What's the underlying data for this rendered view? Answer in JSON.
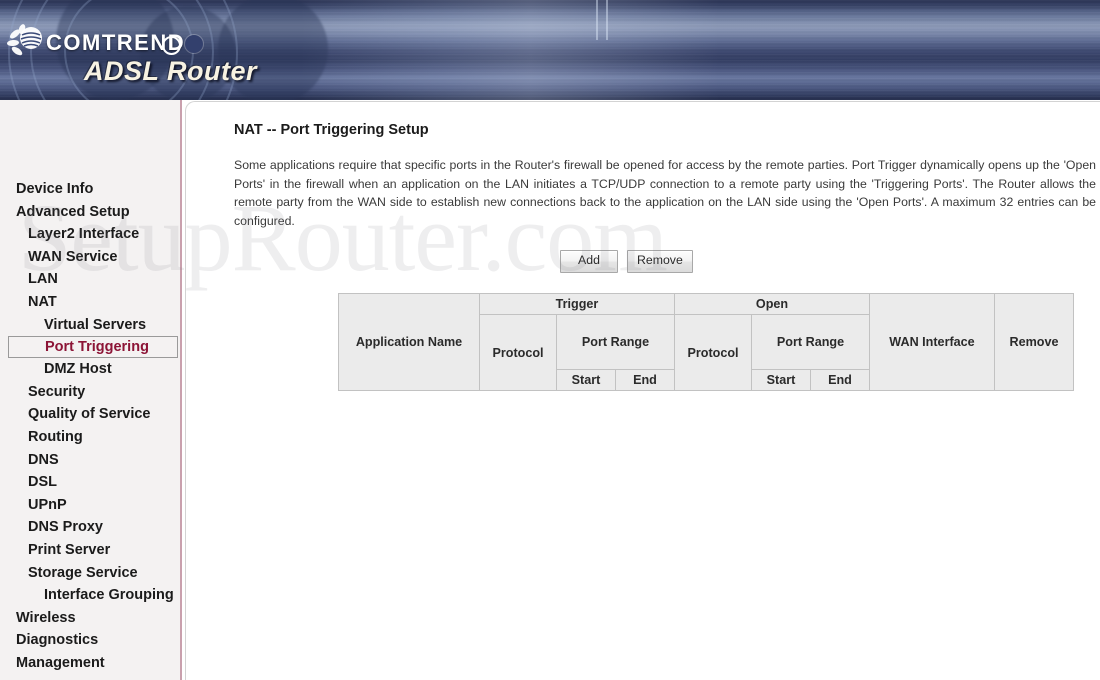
{
  "banner": {
    "brand_name": "COMTREND",
    "product_title": "ADSL Router",
    "logo_icon": "comtrend-flower-logo",
    "accent_dark": "#2a3355",
    "accent_light": "#8e9bba",
    "title_color": "#f7f2e2"
  },
  "watermark": {
    "text": "SetupRouter.com"
  },
  "sidebar": {
    "active_item": "Port Triggering",
    "active_color": "#8c1436",
    "border_color": "#c9a0ad",
    "background": "#f4f2f2",
    "items": [
      {
        "label": "Device Info",
        "level": 0,
        "active": false
      },
      {
        "label": "Advanced Setup",
        "level": 0,
        "active": false
      },
      {
        "label": "Layer2 Interface",
        "level": 1,
        "active": false
      },
      {
        "label": "WAN Service",
        "level": 1,
        "active": false
      },
      {
        "label": "LAN",
        "level": 1,
        "active": false
      },
      {
        "label": "NAT",
        "level": 1,
        "active": false
      },
      {
        "label": "Virtual Servers",
        "level": 2,
        "active": false
      },
      {
        "label": "Port Triggering",
        "level": 2,
        "active": true
      },
      {
        "label": "DMZ Host",
        "level": 2,
        "active": false
      },
      {
        "label": "Security",
        "level": 1,
        "active": false
      },
      {
        "label": "Quality of Service",
        "level": 1,
        "active": false
      },
      {
        "label": "Routing",
        "level": 1,
        "active": false
      },
      {
        "label": "DNS",
        "level": 1,
        "active": false
      },
      {
        "label": "DSL",
        "level": 1,
        "active": false
      },
      {
        "label": "UPnP",
        "level": 1,
        "active": false
      },
      {
        "label": "DNS Proxy",
        "level": 1,
        "active": false
      },
      {
        "label": "Print Server",
        "level": 1,
        "active": false
      },
      {
        "label": "Storage Service",
        "level": 1,
        "active": false
      },
      {
        "label": "Interface Grouping",
        "level": 2,
        "active": false
      },
      {
        "label": "Wireless",
        "level": 0,
        "active": false
      },
      {
        "label": "Diagnostics",
        "level": 0,
        "active": false
      },
      {
        "label": "Management",
        "level": 0,
        "active": false
      }
    ]
  },
  "main": {
    "page_title": "NAT -- Port Triggering Setup",
    "description": "Some applications require that specific ports in the Router's firewall be opened for access by the remote parties. Port Trigger dynamically opens up the 'Open Ports' in the firewall when an application on the LAN initiates a TCP/UDP connection to a remote party using the 'Triggering Ports'. The Router allows the remote party from the WAN side to establish new connections back to the application on the LAN side using the 'Open Ports'. A maximum 32 entries can be configured.",
    "buttons": {
      "add_label": "Add",
      "remove_label": "Remove"
    },
    "table": {
      "headers": {
        "application_name": "Application Name",
        "trigger_group": "Trigger",
        "open_group": "Open",
        "trigger_protocol": "Protocol",
        "trigger_port_range": "Port Range",
        "trigger_start": "Start",
        "trigger_end": "End",
        "open_protocol": "Protocol",
        "open_port_range": "Port Range",
        "open_start": "Start",
        "open_end": "End",
        "wan_interface": "WAN Interface",
        "remove": "Remove"
      },
      "rows": []
    }
  }
}
